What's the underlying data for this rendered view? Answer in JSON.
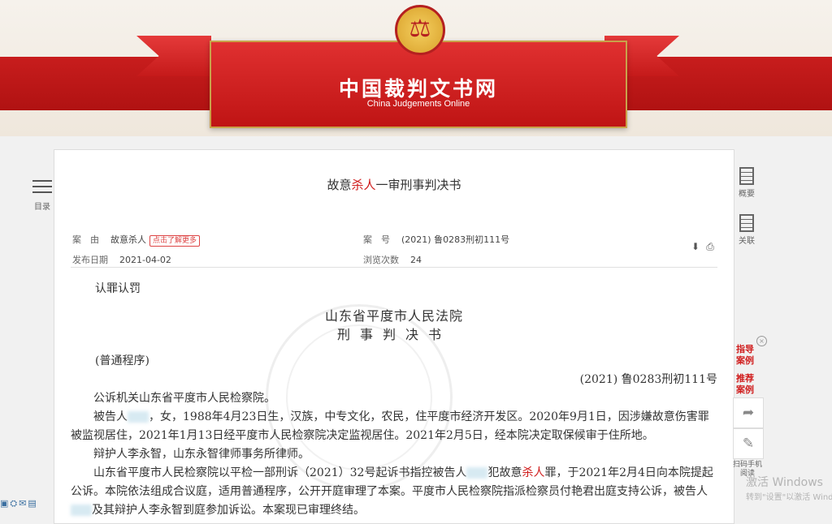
{
  "site": {
    "title": "中国裁判文书网",
    "subtitle": "China Judgements Online",
    "emblem_glyph": "⚖"
  },
  "left_nav": {
    "toc_label": "目录"
  },
  "document": {
    "title_pre": "故意",
    "title_hl": "杀人",
    "title_post": "一审刑事判决书",
    "cause_label": "案　由",
    "cause_value": "故意杀人",
    "cause_tag": "点击了解更多",
    "case_no_label": "案　号",
    "case_no_value": "(2021) 鲁0283刑初111号",
    "publish_label": "发布日期",
    "publish_value": "2021-04-02",
    "views_label": "浏览次数",
    "views_value": "24",
    "download_icon": "download-icon",
    "print_icon": "print-icon"
  },
  "body": {
    "l1": "认罪认罚",
    "court": "山东省平度市人民法院",
    "doc_type": "刑事判决书",
    "procedure": "(普通程序)",
    "case_no": "(2021) 鲁0283刑初111号",
    "p1": "公诉机关山东省平度市人民检察院。",
    "p2a": "被告人",
    "p2b": "，女，1988年4月23日生，汉族，中专文化，农民，住平度市经济开发区。2020年9月1日，因涉嫌故意伤害罪被监视居住，2021年1月13日经平度市人民检察院决定监视居住。2021年2月5日，经本院决定取保候审于住所地。",
    "p3": "辩护人李永智，山东永智律师事务所律师。",
    "p4a": "山东省平度市人民检察院以平检一部刑诉（2021）32号起诉书指控被告人",
    "p4b": "犯故意",
    "p4hl": "杀人",
    "p4c": "罪，于2021年2月4日向本院提起公诉。本院依法组成合议庭，适用普通程序，公开开庭审理了本案。平度市人民检察院指派检察员付艳君出庭支持公诉，被告人",
    "p4d": "及其辩护人李永智到庭参加诉讼。本案现已审理终结。"
  },
  "right_nav": {
    "summary": "概要",
    "related": "关联",
    "guide1": "指导案例",
    "guide2": "推荐案例",
    "share_icon": "share-icon",
    "edit_icon": "edit-icon",
    "scan": "扫码手机阅读"
  },
  "os": {
    "activate1": "激活 Windows",
    "activate2": "转到\"设置\"以激活 Windows"
  }
}
